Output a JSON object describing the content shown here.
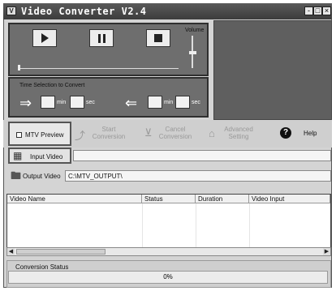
{
  "window": {
    "title": "Video Converter V2.4",
    "icon_letter": "V",
    "buttons": {
      "minimize": "-",
      "maximize": "□",
      "close": "×"
    }
  },
  "player": {
    "volume_label": "Volume",
    "controls": [
      "play-icon",
      "pause-icon",
      "stop-icon"
    ]
  },
  "time_selection": {
    "label": "Time Selection to Convert",
    "start": {
      "min_value": "",
      "sec_value": "",
      "min_unit": "min",
      "sec_unit": "sec"
    },
    "end": {
      "min_value": "",
      "sec_value": "",
      "min_unit": "min",
      "sec_unit": "sec"
    }
  },
  "toolbar": {
    "mtv_preview": "MTV Preview",
    "start_conversion": "Start Conversion",
    "cancel_conversion": "Cancel Conversion",
    "advanced_setting": "Advanced Setting",
    "help": "Help",
    "help_icon_glyph": "?"
  },
  "input_video": {
    "label": "Input Video",
    "value": ""
  },
  "output_video": {
    "label": "Output Video",
    "value": "C:\\MTV_OUTPUT\\"
  },
  "table": {
    "columns": [
      "Video Name",
      "Status",
      "Duration",
      "Video Input"
    ],
    "rows": []
  },
  "conversion_status": {
    "label": "Conversion Status",
    "progress_text": "0%",
    "progress": 0
  },
  "colors": {
    "title_bar": "#4a4a4a",
    "panel_dark": "#6e6e6e",
    "window_bg": "#d4d4d4"
  }
}
